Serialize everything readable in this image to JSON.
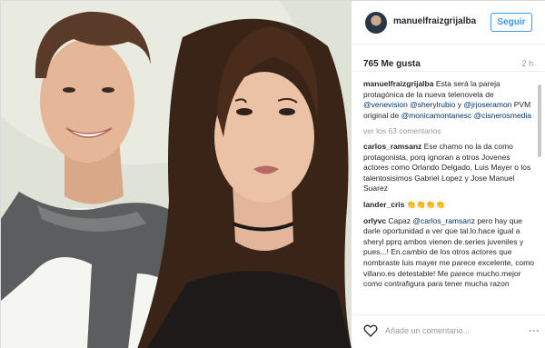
{
  "photo": {
    "alt_icon": "photo-collage"
  },
  "header": {
    "username": "manuelfraizgrijalba",
    "follow_label": "Seguir"
  },
  "stats": {
    "likes": "765 Me gusta",
    "time": "2 h"
  },
  "caption": {
    "user": "manuelfraizgrijalba",
    "text_1": " Esta será la pareja protagónica de la nueva telenovela de ",
    "mention_1": "@venevision",
    "sep_1": " ",
    "mention_2": "@sherylrubio",
    "text_2": " y ",
    "mention_3": "@jrjoseramon",
    "text_3": " PVM original de ",
    "mention_4": "@monicamontanesc",
    "sep_2": " ",
    "mention_5": "@cisnerosmedia"
  },
  "view_all": "ver los 63 comentarios",
  "comments": [
    {
      "user": "carlos_ramsanz",
      "text": " Ese chamo no la da como protagonista, porq ignoran a otros Jovenes actores como Orlando Delgado, Luis Mayer o los talentosisimos Gabriel Lopez y Jose Manuel Suarez"
    },
    {
      "user": "lander_cris",
      "text": " 👏👏👏👏"
    },
    {
      "user": "orlyvc",
      "text_1": " Capaz ",
      "mention": "@carlos_ramsanz",
      "text_2": " pero hay que darle oportunidad a ver que tal.lo.hace igual a sheryl pprq ambos vienen de.series juveniles y pues...! En.cambio de los otros actores que nombraste luis mayer me parece excelente, como villano.es detestable! Me parece mucho.mejor como contrafigura para tener mucha razon"
    }
  ],
  "footer": {
    "placeholder": "Añade un comentario...",
    "more": "···"
  },
  "colors": {
    "accent": "#3897f0",
    "mention": "#003569",
    "muted": "#999999"
  }
}
